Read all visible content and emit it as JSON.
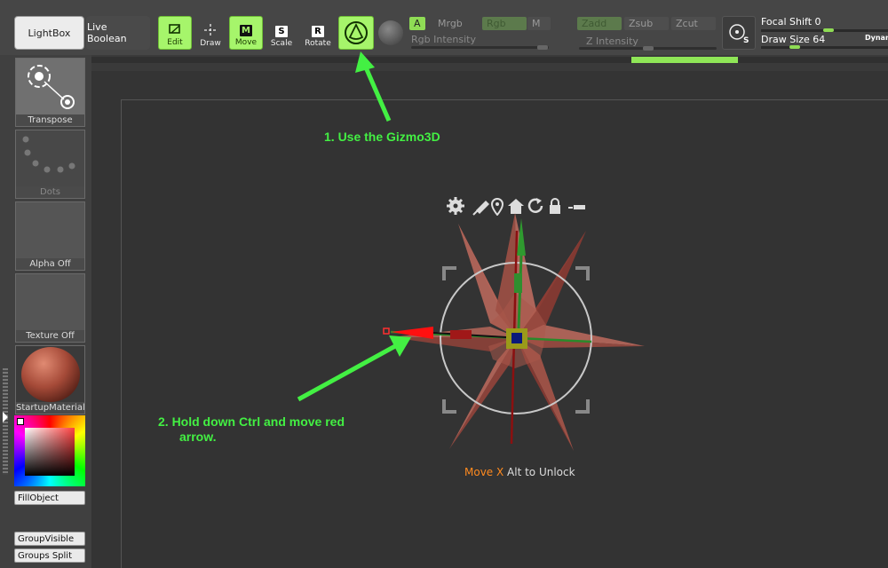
{
  "toolbar": {
    "lightbox": "LightBox",
    "live_boolean": "Live Boolean",
    "tools": [
      {
        "label": "Edit",
        "icon": "edit-icon",
        "active": true
      },
      {
        "label": "Draw",
        "icon": "draw-icon",
        "active": false
      },
      {
        "label": "Move",
        "icon": "move-icon",
        "glyph": "M",
        "active": true
      },
      {
        "label": "Scale",
        "icon": "scale-icon",
        "glyph": "S",
        "active": false
      },
      {
        "label": "Rotate",
        "icon": "rotate-icon",
        "glyph": "R",
        "active": false
      }
    ],
    "gizmo_icon": "gizmo3d-icon",
    "modes_rgb": {
      "a": "A",
      "mrgb": "Mrgb",
      "rgb": "Rgb",
      "m": "M",
      "intensity_label": "Rgb Intensity"
    },
    "modes_z": {
      "zadd": "Zadd",
      "zsub": "Zsub",
      "zcut": "Zcut",
      "intensity_label": "Z Intensity"
    },
    "focal_shift": "Focal Shift 0",
    "draw_size": "Draw Size 64",
    "dynamic": "Dynam"
  },
  "left_panel": {
    "transpose": "Transpose",
    "dots": "Dots",
    "alpha": "Alpha Off",
    "texture": "Texture Off",
    "material": "StartupMaterial",
    "fill_object": "FillObject",
    "group_visible": "GroupVisible",
    "groups_split": "Groups Split"
  },
  "canvas": {
    "annotation_1": "1.  Use the Gizmo3D",
    "annotation_2_line1": "2.  Hold down Ctrl and move red",
    "annotation_2_line2": "arrow.",
    "status_axis": "Move X",
    "status_rest": " Alt to Unlock"
  },
  "colors": {
    "accent_green": "#a6f56b",
    "annotation_green": "#43f043",
    "star_fill": "#a4584d"
  }
}
